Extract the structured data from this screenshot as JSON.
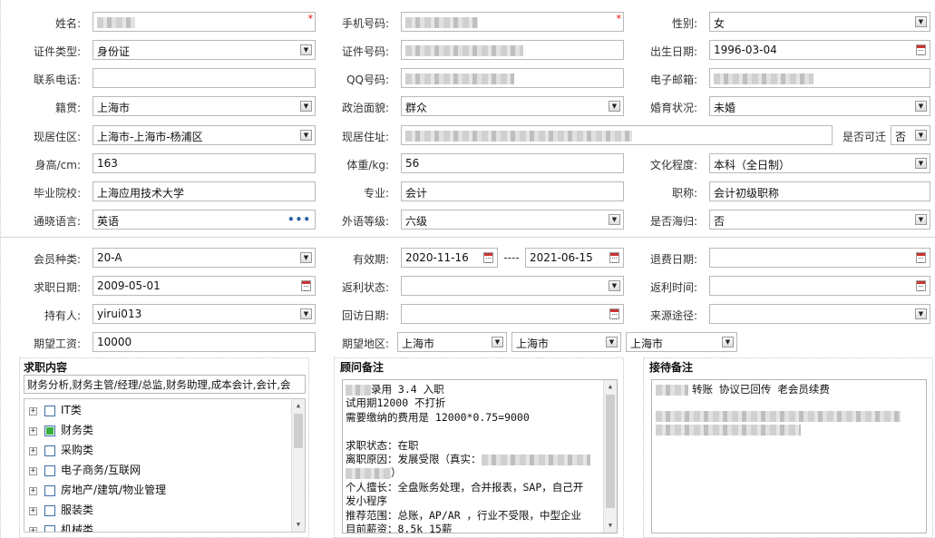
{
  "basic": {
    "name": {
      "label": "姓名:",
      "required": "*"
    },
    "phone": {
      "label": "手机号码:",
      "required": "*"
    },
    "gender": {
      "label": "性别:",
      "value": "女"
    },
    "id_type": {
      "label": "证件类型:",
      "value": "身份证"
    },
    "id_no": {
      "label": "证件号码:"
    },
    "birth": {
      "label": "出生日期:",
      "value": "1996-03-04"
    },
    "contact_phone": {
      "label": "联系电话:",
      "value": ""
    },
    "qq": {
      "label": "QQ号码:"
    },
    "email": {
      "label": "电子邮箱:"
    },
    "native": {
      "label": "籍贯:",
      "value": "上海市"
    },
    "politics": {
      "label": "政治面貌:",
      "value": "群众"
    },
    "marital": {
      "label": "婚育状况:",
      "value": "未婚"
    },
    "residence": {
      "label": "现居住区:",
      "value": "上海市-上海市-杨浦区"
    },
    "address": {
      "label": "现居住址:"
    },
    "relocate": {
      "label": "是否可迁",
      "value": "否"
    },
    "height": {
      "label": "身高/cm:",
      "value": "163"
    },
    "weight": {
      "label": "体重/kg:",
      "value": "56"
    },
    "education": {
      "label": "文化程度:",
      "value": "本科（全日制）"
    },
    "school": {
      "label": "毕业院校:",
      "value": "上海应用技术大学"
    },
    "major": {
      "label": "专业:",
      "value": "会计"
    },
    "title": {
      "label": "职称:",
      "value": "会计初级职称"
    },
    "language": {
      "label": "通晓语言:",
      "value": "英语",
      "more": "•••"
    },
    "lang_level": {
      "label": "外语等级:",
      "value": "六级"
    },
    "overseas": {
      "label": "是否海归:",
      "value": "否"
    }
  },
  "member": {
    "type": {
      "label": "会员种类:",
      "value": "20-A"
    },
    "valid": {
      "label": "有效期:",
      "from": "2020-11-16",
      "sep": "----",
      "to": "2021-06-15"
    },
    "refund_date": {
      "label": "退费日期:",
      "value": ""
    },
    "job_date": {
      "label": "求职日期:",
      "value": "2009-05-01"
    },
    "rebate_status": {
      "label": "返利状态:",
      "value": ""
    },
    "rebate_time": {
      "label": "返利时间:",
      "value": ""
    },
    "holder": {
      "label": "持有人:",
      "value": "yirui013"
    },
    "visit_date": {
      "label": "回访日期:",
      "value": ""
    },
    "source": {
      "label": "来源途径:",
      "value": ""
    },
    "salary": {
      "label": "期望工资:",
      "value": "10000"
    },
    "region": {
      "label": "期望地区:",
      "values": [
        "上海市",
        "上海市",
        "上海市"
      ]
    }
  },
  "job_panel": {
    "title": "求职内容",
    "summary": "财务分析,财务主管/经理/总监,财务助理,成本会计,会计,会",
    "tree": [
      {
        "label": "IT类",
        "checked": false
      },
      {
        "label": "财务类",
        "checked": true
      },
      {
        "label": "采购类",
        "checked": false
      },
      {
        "label": "电子商务/互联网",
        "checked": false
      },
      {
        "label": "房地产/建筑/物业管理",
        "checked": false
      },
      {
        "label": "服装类",
        "checked": false
      },
      {
        "label": "机械类",
        "checked": false
      }
    ]
  },
  "advisor_panel": {
    "title": "顾问备注",
    "lines": [
      "录用  3.4 入职",
      "试用期12000  不打折",
      "需要缴纳的费用是 12000*0.75=9000",
      "",
      "求职状态：在职",
      "离职原因：发展受限（真实：",
      "）",
      "个人擅长：全盘账务处理，合并报表，SAP，自己开",
      "发小程序",
      "推荐范围：总账，AP/AR ，行业不受限，中型企业",
      "目前薪资：8.5k 15薪"
    ]
  },
  "reception_panel": {
    "title": "接待备注",
    "line1": "转账 协议已回传 老会员续费"
  },
  "icons": {
    "dropdown": "▼",
    "expand": "+",
    "scroll_up": "▲",
    "scroll_down": "▼"
  }
}
